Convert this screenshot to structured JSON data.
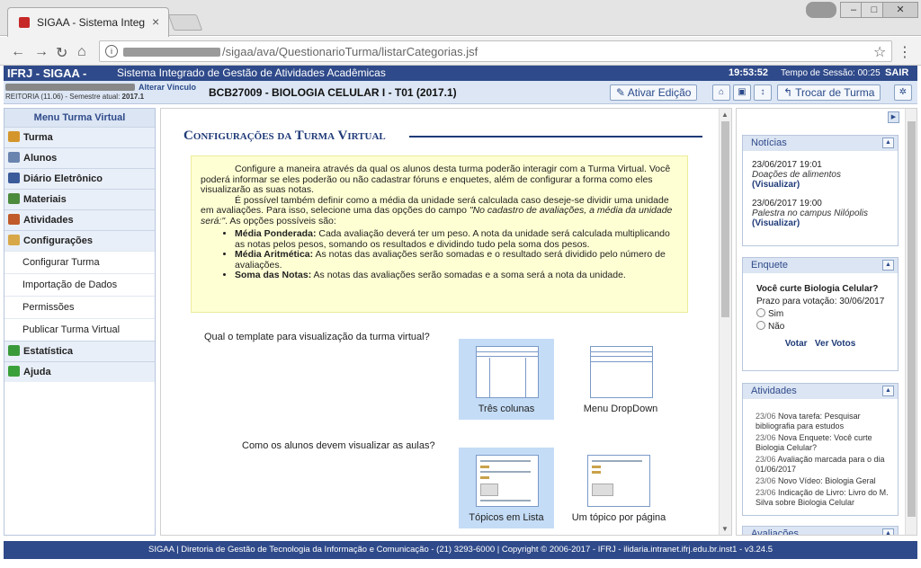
{
  "browser": {
    "tab_title": "SIGAA - Sistema Integrac",
    "url_path": "/sigaa/ava/QuestionarioTurma/listarCategorias.jsf"
  },
  "header": {
    "sys_name": "IFRJ - SIGAA -",
    "sys_full": "Sistema Integrado de Gestão de Atividades Acadêmicas",
    "clock": "19:53:52",
    "session_label": "Tempo de Sessão: 00:25",
    "logout": "SAIR"
  },
  "infobar": {
    "alterar_vinculo": "Alterar Vínculo",
    "reitoria": "REITORIA (11.06) - Semestre atual:",
    "semestre": "2017.1",
    "disciplina": "BCB27009 - BIOLOGIA CELULAR I - T01 (2017.1)",
    "ativar_edicao": "Ativar Edição",
    "trocar_turma": "Trocar de Turma"
  },
  "menu": {
    "title": "Menu Turma Virtual",
    "items": [
      {
        "label": "Turma",
        "color": "#d4962c"
      },
      {
        "label": "Alunos",
        "color": "#6a84b0"
      },
      {
        "label": "Diário Eletrônico",
        "color": "#3a5a9a"
      },
      {
        "label": "Materiais",
        "color": "#4c8a3c"
      },
      {
        "label": "Atividades",
        "color": "#c05a2a"
      },
      {
        "label": "Configurações",
        "color": "#d8a848"
      }
    ],
    "sub_items": [
      "Configurar Turma",
      "Importação de Dados",
      "Permissões",
      "Publicar Turma Virtual"
    ],
    "items_after": [
      {
        "label": "Estatística",
        "color": "#3a9a3a"
      },
      {
        "label": "Ajuda",
        "color": "#3aa03a"
      }
    ]
  },
  "main": {
    "title": "Configurações da Turma Virtual",
    "notice_p1": "Configure a maneira através da qual os alunos desta turma poderão interagir com a Turma Virtual. Você poderá informar se eles poderão ou não cadastrar fóruns e enquetes, além de configurar a forma como eles visualizarão as suas notas.",
    "notice_p2_a": "É possível também definir como a média da unidade será calculada caso deseje-se dividir uma unidade em avaliações. Para isso, selecione uma das opções do campo",
    "notice_p2_em": "\"No cadastro de avaliações, a média da unidade será:\"",
    "notice_p2_b": ". As opções possíveis são:",
    "bullets": [
      {
        "term": "Média Ponderada:",
        "desc": "Cada avaliação deverá ter um peso. A nota da unidade será calculada multiplicando as notas pelos pesos, somando os resultados e dividindo tudo pela soma dos pesos."
      },
      {
        "term": "Média Aritmética:",
        "desc": "As notas das avaliações serão somadas e o resultado será dividido pelo número de avaliações."
      },
      {
        "term": "Soma das Notas:",
        "desc": "As notas das avaliações serão somadas e a soma será a nota da unidade."
      }
    ],
    "question_template": "Qual o template para visualização da turma virtual?",
    "template_opts": [
      "Três colunas",
      "Menu DropDown"
    ],
    "question_aulas": "Como os alunos devem visualizar as aulas?",
    "aulas_opts": [
      "Tópicos em Lista",
      "Um tópico por página"
    ]
  },
  "right": {
    "noticias_title": "Notícias",
    "noticias": [
      {
        "date": "23/06/2017 19:01",
        "title": "Doações de alimentos",
        "link": "(Visualizar)"
      },
      {
        "date": "23/06/2017 19:00",
        "title": "Palestra no campus Nilópolis",
        "link": "(Visualizar)"
      }
    ],
    "enquete_title": "Enquete",
    "enquete_question": "Você curte Biologia Celular?",
    "enquete_prazo": "Prazo para votação: 30/06/2017",
    "enquete_opts": [
      "Sim",
      "Não"
    ],
    "votar": "Votar",
    "ver_votos": "Ver Votos",
    "atividades_title": "Atividades",
    "atividades": [
      {
        "date": "23/06",
        "text": "Nova tarefa: Pesquisar bibliografia para estudos"
      },
      {
        "date": "23/06",
        "text": "Nova Enquete: Você curte Biologia Celular?"
      },
      {
        "date": "23/06",
        "text": "Avaliação marcada para o dia 01/06/2017"
      },
      {
        "date": "23/06",
        "text": "Novo Vídeo: Biologia Geral"
      },
      {
        "date": "23/06",
        "text": "Indicação de Livro: Livro do M. Silva sobre Biologia Celular"
      }
    ],
    "avaliacoes_title": "Avaliações"
  },
  "footer": "SIGAA | Diretoria de Gestão de Tecnologia da Informação e Comunicação - (21) 3293-6000 | Copyright © 2006-2017 - IFRJ - ilidaria.intranet.ifrj.edu.br.inst1 - v3.24.5"
}
